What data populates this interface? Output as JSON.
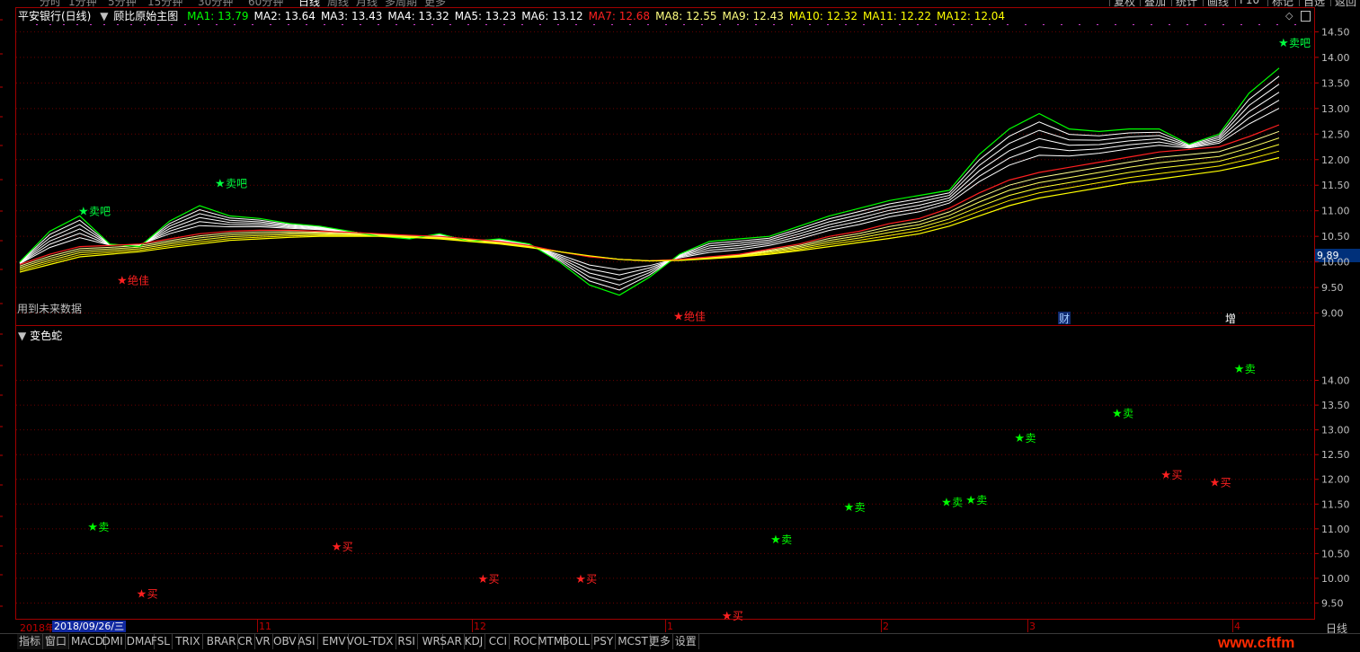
{
  "top_menu": {
    "items": [
      "分时",
      "1分钟",
      "5分钟",
      "15分钟",
      "30分钟",
      "60分钟",
      "日线",
      "周线",
      "月线",
      "多周期",
      "更多"
    ],
    "buttons": [
      "复权",
      "叠加",
      "统计",
      "画线",
      "F10",
      "标记",
      "自选",
      "返回"
    ]
  },
  "main_panel": {
    "stock_title": "平安银行(日线)",
    "indicator_name": "顾比原始主图",
    "ma_values": [
      {
        "label": "MA1: 13.79",
        "color": "#00ff00"
      },
      {
        "label": "MA2: 13.64",
        "color": "#ffffff"
      },
      {
        "label": "MA3: 13.43",
        "color": "#ffffff"
      },
      {
        "label": "MA4: 13.32",
        "color": "#ffffff"
      },
      {
        "label": "MA5: 13.23",
        "color": "#ffffff"
      },
      {
        "label": "MA6: 13.12",
        "color": "#ffffff"
      },
      {
        "label": "MA7: 12.68",
        "color": "#ff2020"
      },
      {
        "label": "MA8: 12.55",
        "color": "#ffff80"
      },
      {
        "label": "MA9: 12.43",
        "color": "#ffff80"
      },
      {
        "label": "MA10: 12.32",
        "color": "#ffff00"
      },
      {
        "label": "MA11: 12.22",
        "color": "#ffff00"
      },
      {
        "label": "MA12: 12.04",
        "color": "#ffff00"
      }
    ],
    "note": "用到未来数据",
    "current_price": "9.89",
    "y_axis": [
      "14.50",
      "14.00",
      "13.50",
      "13.00",
      "12.50",
      "12.00",
      "11.50",
      "11.00",
      "10.50",
      "10.00",
      "9.50",
      "9.00"
    ],
    "signals": [
      {
        "text": "卖吧",
        "type": "sell"
      },
      {
        "text": "卖吧",
        "type": "sell"
      },
      {
        "text": "卖吧",
        "type": "sell"
      },
      {
        "text": "绝佳",
        "type": "buy"
      },
      {
        "text": "绝佳",
        "type": "buy"
      }
    ],
    "event_badges": [
      "财",
      "增"
    ]
  },
  "sub_panel": {
    "indicator_name": "变色蛇",
    "y_axis": [
      "14.00",
      "13.50",
      "13.00",
      "12.50",
      "12.00",
      "11.50",
      "11.00",
      "10.50",
      "10.00",
      "9.50"
    ],
    "sell_label": "卖",
    "buy_label": "买"
  },
  "time_axis": {
    "start_year": "2018年",
    "cursor_date": "2018/09/26/三",
    "months": [
      "11",
      "12",
      "1",
      "2",
      "3",
      "4"
    ],
    "period": "日线"
  },
  "bottom_tabs": [
    "指标",
    "窗口",
    "MACD",
    "DMI",
    "DMA",
    "FSL",
    "TRIX",
    "BRAR",
    "CR",
    "VR",
    "OBV",
    "ASI",
    "EMV",
    "VOL-TDX",
    "RSI",
    "WR",
    "SAR",
    "KDJ",
    "CCI",
    "ROC",
    "MTM",
    "BOLL",
    "PSY",
    "MCST",
    "更多",
    "设置"
  ],
  "watermark": "www.cftfm",
  "chart_data": [
    {
      "type": "line",
      "title": "顾比原始主图",
      "ylim": [
        8.8,
        14.7
      ],
      "grid": true,
      "series": [
        {
          "name": "MA1",
          "color": "#00ff00",
          "values": [
            10.0,
            10.6,
            10.9,
            10.35,
            10.3,
            10.8,
            11.1,
            10.9,
            10.85,
            10.75,
            10.7,
            10.6,
            10.5,
            10.45,
            10.55,
            10.4,
            10.45,
            10.35,
            10.0,
            9.55,
            9.35,
            9.7,
            10.15,
            10.4,
            10.45,
            10.5,
            10.7,
            10.9,
            11.05,
            11.2,
            11.3,
            11.4,
            12.1,
            12.6,
            12.9,
            12.6,
            12.55,
            12.6,
            12.6,
            12.3,
            12.5,
            13.3,
            13.79
          ]
        },
        {
          "name": "MA7",
          "color": "#ff2020",
          "values": [
            9.95,
            10.15,
            10.3,
            10.32,
            10.35,
            10.45,
            10.55,
            10.6,
            10.62,
            10.62,
            10.6,
            10.58,
            10.55,
            10.52,
            10.5,
            10.45,
            10.4,
            10.32,
            10.2,
            10.1,
            10.05,
            10.02,
            10.05,
            10.1,
            10.15,
            10.25,
            10.35,
            10.5,
            10.6,
            10.75,
            10.85,
            11.05,
            11.35,
            11.6,
            11.75,
            11.85,
            11.95,
            12.05,
            12.15,
            12.2,
            12.25,
            12.45,
            12.68
          ]
        },
        {
          "name": "MA12",
          "color": "#ffff00",
          "values": [
            9.8,
            9.95,
            10.1,
            10.15,
            10.2,
            10.28,
            10.35,
            10.42,
            10.45,
            10.48,
            10.5,
            10.5,
            10.5,
            10.48,
            10.45,
            10.4,
            10.35,
            10.28,
            10.2,
            10.12,
            10.05,
            10.02,
            10.03,
            10.06,
            10.1,
            10.15,
            10.22,
            10.3,
            10.38,
            10.46,
            10.55,
            10.7,
            10.9,
            11.1,
            11.25,
            11.35,
            11.45,
            11.55,
            11.62,
            11.7,
            11.78,
            11.9,
            12.04
          ]
        }
      ]
    },
    {
      "type": "scatter",
      "title": "变色蛇",
      "ylim": [
        9.2,
        14.7
      ],
      "grid": true,
      "series": [
        {
          "name": "卖",
          "color": "#00ff00",
          "x": [
            3,
            31,
            34,
            38,
            39,
            41,
            45,
            50
          ],
          "values": [
            11.05,
            10.8,
            11.45,
            11.55,
            11.6,
            12.85,
            13.35,
            14.25
          ]
        },
        {
          "name": "买",
          "color": "#ff2020",
          "x": [
            5,
            13,
            19,
            23,
            29,
            47,
            49
          ],
          "values": [
            9.7,
            10.65,
            10.0,
            10.0,
            9.25,
            12.1,
            11.95
          ]
        }
      ]
    }
  ]
}
